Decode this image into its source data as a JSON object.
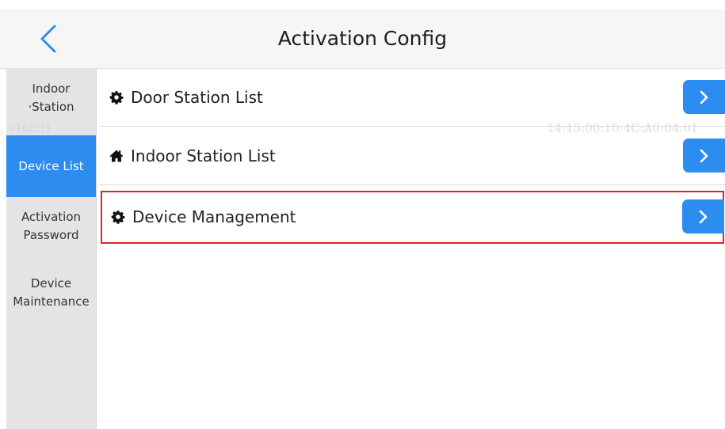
{
  "header": {
    "title": "Activation Config",
    "back_icon": "chevron-left-icon"
  },
  "sidebar": {
    "items": [
      {
        "label_line1": "Indoor",
        "label_line2": "·Station",
        "active": false
      },
      {
        "label_line1": "Device List",
        "label_line2": "",
        "active": true
      },
      {
        "label_line1": "Activation",
        "label_line2": "Password",
        "active": false
      },
      {
        "label_line1": "Device",
        "label_line2": "Maintenance",
        "active": false
      }
    ]
  },
  "watermark": {
    "left": "v16531",
    "right": "14:15:00:10:4C:A0:04:01"
  },
  "main": {
    "rows": [
      {
        "label": "Door Station List",
        "icon": "gear-icon"
      },
      {
        "label": "Indoor Station List",
        "icon": "home-icon"
      },
      {
        "label": "Device Management",
        "icon": "gear-icon",
        "highlighted": true
      }
    ]
  },
  "colors": {
    "accent": "#2d8cf0",
    "highlight_border": "#e1242a",
    "header_bg": "#f6f7f4",
    "sidebar_bg": "#e4e4e4"
  }
}
